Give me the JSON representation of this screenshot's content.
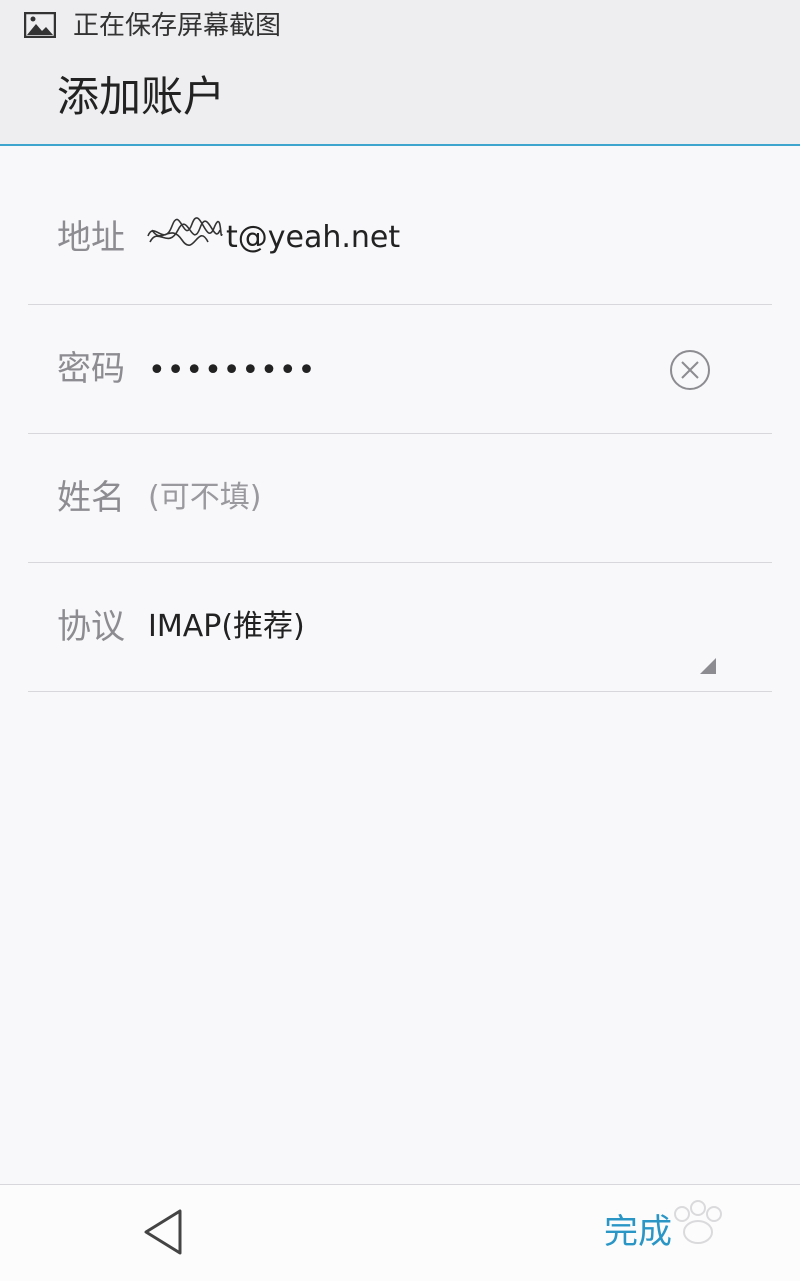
{
  "status_bar": {
    "text": "正在保存屏幕截图",
    "icon": "image-icon"
  },
  "header": {
    "title": "添加账户"
  },
  "form": {
    "address": {
      "label": "地址",
      "value": "t@yeah.net"
    },
    "password": {
      "label": "密码",
      "value": "•••••••••",
      "clear_icon": "clear-circle-icon"
    },
    "name": {
      "label": "姓名",
      "placeholder": "(可不填)"
    },
    "protocol": {
      "label": "协议",
      "value": "IMAP(推荐)",
      "dropdown_icon": "dropdown-triangle-icon"
    }
  },
  "bottom_bar": {
    "done_label": "完成",
    "back_icon": "back-triangle-icon"
  },
  "colors": {
    "accent": "#2a96c6",
    "header_line": "#3ea5cf",
    "label": "#8d8d91",
    "background": "#f8f7fa"
  }
}
